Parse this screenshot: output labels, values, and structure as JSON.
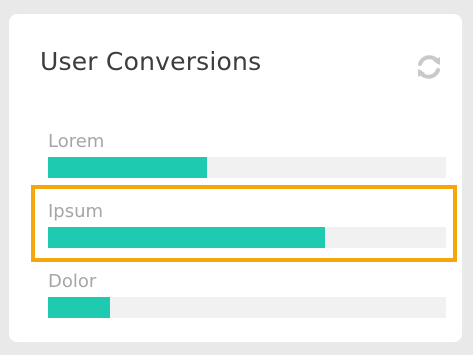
{
  "widget": {
    "title": "User Conversions",
    "refresh_icon": "refresh-icon",
    "rows": [
      {
        "label": "Lorem",
        "progress": 0.4
      },
      {
        "label": "Ipsum",
        "progress": 0.695
      },
      {
        "label": "Dolor",
        "progress": 0.155
      }
    ]
  },
  "highlight": {
    "row": "Ipsum"
  },
  "colors": {
    "background": "#e9e9e9",
    "card": "#ffffff",
    "bar_fill": "#1ecbb0",
    "bar_track": "#f1f1f1",
    "title": "#3d3d3d",
    "label": "#a6a6a6",
    "highlight": "#f4a70b"
  }
}
